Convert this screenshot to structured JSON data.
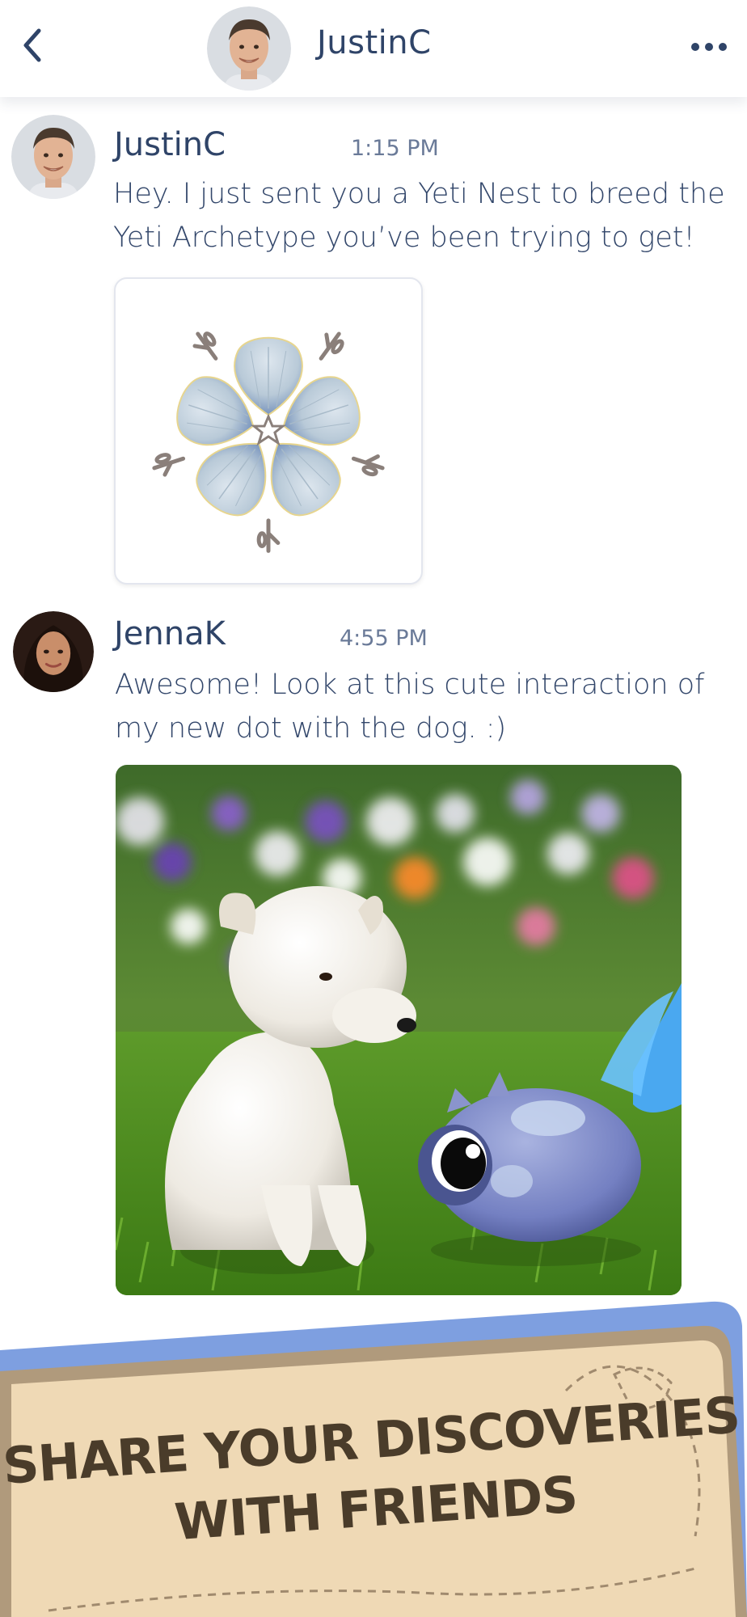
{
  "header": {
    "title": "JustinC",
    "back_icon": "chevron-left-icon",
    "more_icon": "more-horizontal-icon"
  },
  "messages": [
    {
      "author": "JustinC",
      "time": "1:15 PM",
      "lines": [
        "Hey. I just sent you a Yeti Nest to breed the",
        "Yeti Archetype you’ve been trying to get!"
      ],
      "attachment": "yeti-nest-image"
    },
    {
      "author": "JennaK",
      "time": "4:55 PM",
      "lines": [
        "Awesome! Look at this cute interaction of",
        "my new dot with the dog. :)"
      ],
      "attachment": "puppy-and-creature-photo"
    }
  ],
  "banner": {
    "line1": "SHARE YOUR DISCOVERIES",
    "line2": "WITH FRIENDS"
  },
  "colors": {
    "text": "#2f4468",
    "time": "#6a7a98",
    "banner_paper": "#efd9b5",
    "banner_border": "#b09a7c",
    "banner_blue": "#7e9fe0",
    "banner_text": "#4a3c2a"
  }
}
